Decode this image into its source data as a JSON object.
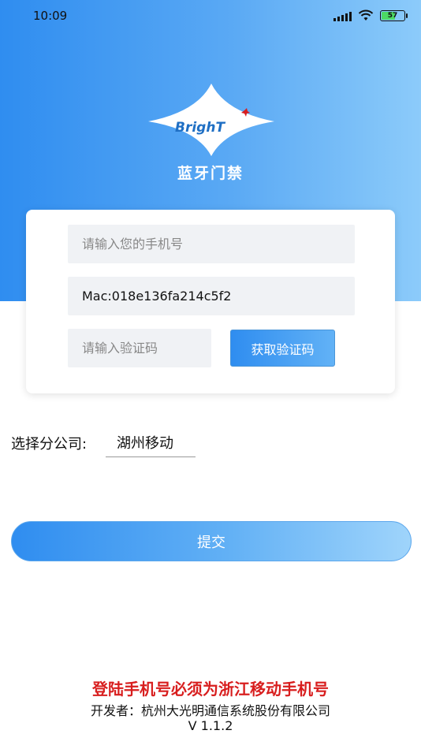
{
  "status_bar": {
    "time": "10:09",
    "battery": "57",
    "icons": [
      "signal-icon",
      "wifi-icon",
      "battery-icon"
    ]
  },
  "header": {
    "logo_text": "BrighT",
    "title": "蓝牙门禁"
  },
  "form": {
    "phone_placeholder": "请输入您的手机号",
    "phone_value": "",
    "mac_value": "Mac:018e136fa214c5f2",
    "code_placeholder": "请输入验证码",
    "code_value": "",
    "get_code_label": "获取验证码"
  },
  "branch": {
    "label": "选择分公司:",
    "selected": "湖州移动"
  },
  "submit_label": "提交",
  "footer": {
    "notice": "登陆手机号必须为浙江移动手机号",
    "developer": "开发者：杭州大光明通信系统股份有限公司",
    "version": "V 1.1.2"
  },
  "colors": {
    "primary": "#2f8df0",
    "primary_light": "#8ccbfa",
    "field_bg": "#f0f2f5",
    "notice_red": "#d81e1e"
  }
}
